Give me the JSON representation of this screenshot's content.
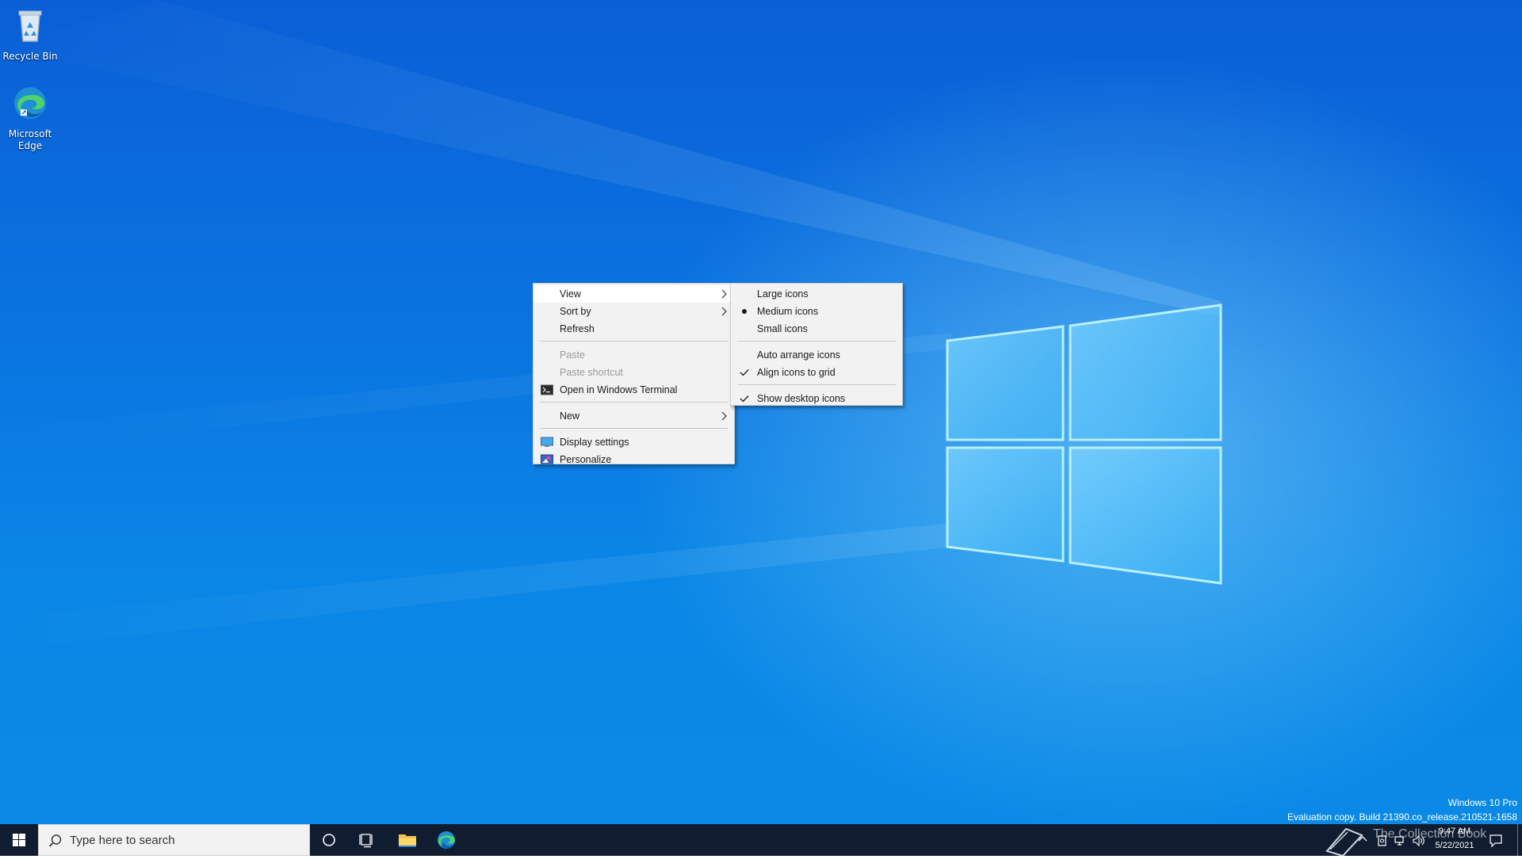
{
  "desktop": {
    "icons": [
      {
        "label": "Recycle Bin",
        "icon": "recycle-bin-icon"
      },
      {
        "label": "Microsoft Edge",
        "icon": "edge-icon"
      }
    ],
    "watermark": {
      "line1": "Windows 10 Pro",
      "line2": "Evaluation copy. Build 21390.co_release.210521-1658"
    },
    "overlay_text": "The Collection Book"
  },
  "context_menu": {
    "items": [
      {
        "label": "View",
        "submenu": true,
        "highlighted": true
      },
      {
        "label": "Sort by",
        "submenu": true
      },
      {
        "label": "Refresh"
      },
      {
        "label": "Paste",
        "disabled": true
      },
      {
        "label": "Paste shortcut",
        "disabled": true
      },
      {
        "label": "Open in Windows Terminal",
        "icon": "terminal-icon"
      },
      {
        "label": "New",
        "submenu": true
      },
      {
        "label": "Display settings",
        "icon": "display-icon"
      },
      {
        "label": "Personalize",
        "icon": "personalize-icon"
      }
    ]
  },
  "view_submenu": {
    "items": [
      {
        "label": "Large icons"
      },
      {
        "label": "Medium icons",
        "selected": true
      },
      {
        "label": "Small icons"
      },
      {
        "label": "Auto arrange icons"
      },
      {
        "label": "Align icons to grid",
        "checked": true
      },
      {
        "label": "Show desktop icons",
        "checked": true
      }
    ]
  },
  "taskbar": {
    "search_placeholder": "Type here to search",
    "clock": {
      "time": "9:47 AM",
      "date": "5/22/2021"
    }
  },
  "colors": {
    "taskbar": "#101c30",
    "menu_bg": "#f2f2f2",
    "accent": "#0a74e0"
  }
}
